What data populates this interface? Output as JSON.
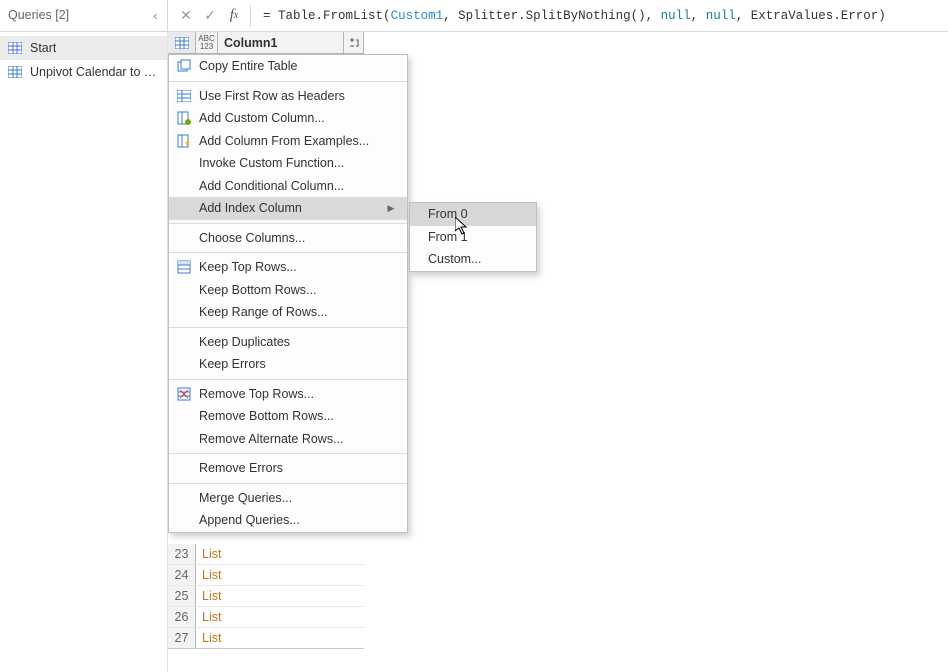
{
  "queries": {
    "header": "Queries [2]",
    "items": [
      {
        "label": "Start"
      },
      {
        "label": "Unpivot Calendar to T..."
      }
    ]
  },
  "formula": {
    "prefix": "= ",
    "fn1": "Table.FromList",
    "p_open": "(",
    "arg1": "Custom1",
    "c1": ", ",
    "fn2": "Splitter.SplitByNothing",
    "empty_parens": "()",
    "c2": ", ",
    "null1": "null",
    "c3": ", ",
    "null2": "null",
    "c4": ", ",
    "fn3": "ExtraValues.Error",
    "p_close": ")"
  },
  "grid": {
    "col1_name": "Column1",
    "type_top": "ABC",
    "type_bot": "123",
    "rows": [
      {
        "rn": "23",
        "val": "List"
      },
      {
        "rn": "24",
        "val": "List"
      },
      {
        "rn": "25",
        "val": "List"
      },
      {
        "rn": "26",
        "val": "List"
      },
      {
        "rn": "27",
        "val": "List"
      }
    ]
  },
  "context_menu": {
    "hover_index": 7,
    "groups": [
      [
        {
          "label": "Copy Entire Table",
          "icon": "copy"
        }
      ],
      [
        {
          "label": "Use First Row as Headers",
          "icon": "table"
        },
        {
          "label": "Add Custom Column...",
          "icon": "column-add"
        },
        {
          "label": "Add Column From Examples...",
          "icon": "column-star"
        },
        {
          "label": "Invoke Custom Function..."
        },
        {
          "label": "Add Conditional Column..."
        },
        {
          "label": "Add Index Column",
          "submenu": true
        }
      ],
      [
        {
          "label": "Choose Columns..."
        }
      ],
      [
        {
          "label": "Keep Top Rows...",
          "icon": "keep-rows"
        },
        {
          "label": "Keep Bottom Rows..."
        },
        {
          "label": "Keep Range of Rows..."
        }
      ],
      [
        {
          "label": "Keep Duplicates"
        },
        {
          "label": "Keep Errors"
        }
      ],
      [
        {
          "label": "Remove Top Rows...",
          "icon": "remove-rows"
        },
        {
          "label": "Remove Bottom Rows..."
        },
        {
          "label": "Remove Alternate Rows..."
        }
      ],
      [
        {
          "label": "Remove Errors"
        }
      ],
      [
        {
          "label": "Merge Queries..."
        },
        {
          "label": "Append Queries..."
        }
      ]
    ]
  },
  "submenu": {
    "hover_index": 0,
    "items": [
      {
        "label": "From 0"
      },
      {
        "label": "From 1"
      },
      {
        "label": "Custom..."
      }
    ]
  }
}
